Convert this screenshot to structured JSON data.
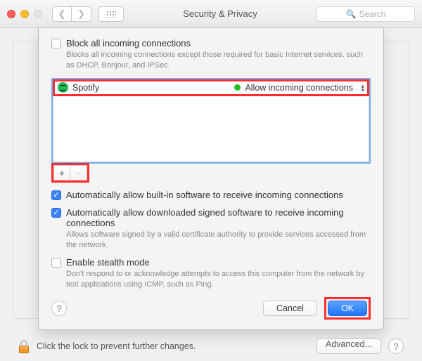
{
  "window": {
    "title": "Security & Privacy",
    "search_placeholder": "Search"
  },
  "sheet": {
    "block_all": {
      "label": "Block all incoming connections",
      "sub": "Blocks all incoming connections except those required for basic Internet services, such as DHCP, Bonjour, and IPSec."
    },
    "app_row": {
      "name": "Spotify",
      "status": "Allow incoming connections"
    },
    "auto_builtin": {
      "label": "Automatically allow built-in software to receive incoming connections"
    },
    "auto_signed": {
      "label": "Automatically allow downloaded signed software to receive incoming connections",
      "sub": "Allows software signed by a valid certificate authority to provide services accessed from the network."
    },
    "stealth": {
      "label": "Enable stealth mode",
      "sub": "Don't respond to or acknowledge attempts to access this computer from the network by test applications using ICMP, such as Ping."
    },
    "buttons": {
      "cancel": "Cancel",
      "ok": "OK"
    }
  },
  "footer": {
    "lock_text": "Click the lock to prevent further changes.",
    "advanced": "Advanced..."
  }
}
